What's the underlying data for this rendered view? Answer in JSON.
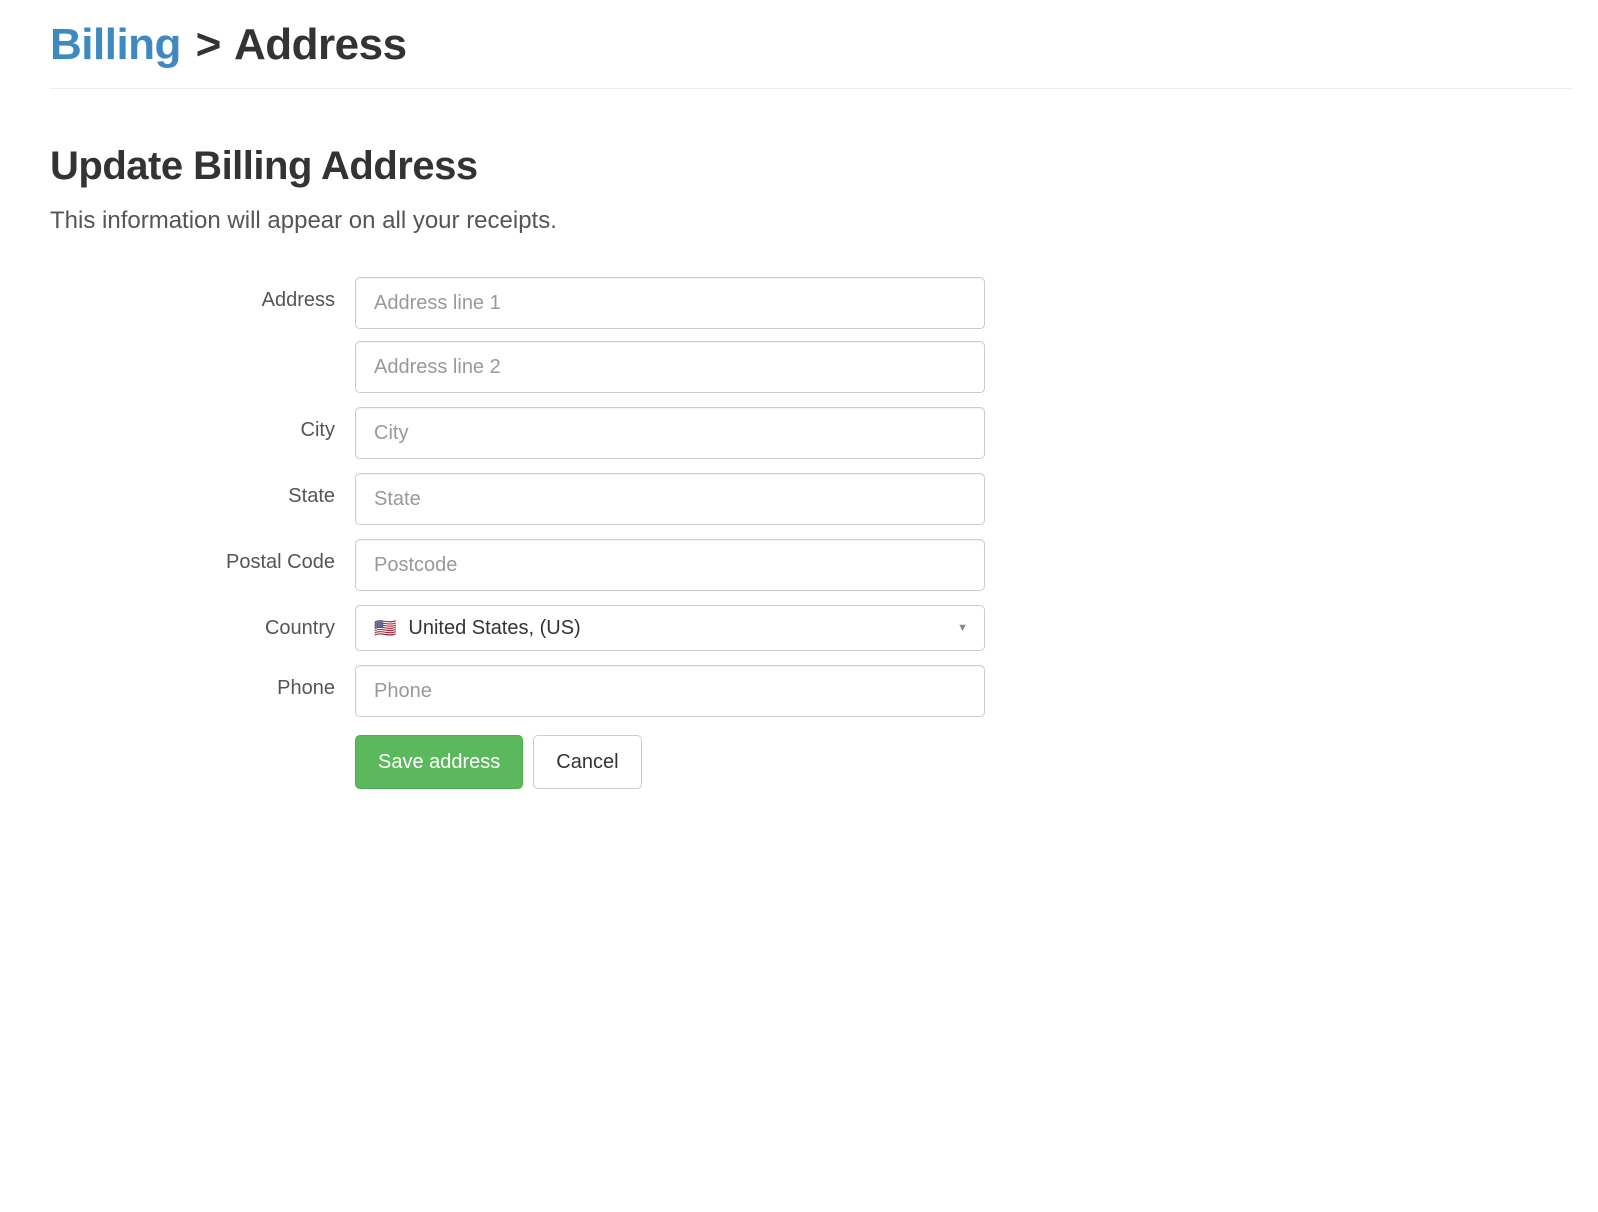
{
  "breadcrumb": {
    "parent": "Billing",
    "separator": ">",
    "current": "Address"
  },
  "header": {
    "title": "Update Billing Address",
    "subtitle": "This information will appear on all your receipts."
  },
  "form": {
    "address": {
      "label": "Address",
      "line1_placeholder": "Address line 1",
      "line1_value": "",
      "line2_placeholder": "Address line 2",
      "line2_value": ""
    },
    "city": {
      "label": "City",
      "placeholder": "City",
      "value": ""
    },
    "state": {
      "label": "State",
      "placeholder": "State",
      "value": ""
    },
    "postal": {
      "label": "Postal Code",
      "placeholder": "Postcode",
      "value": ""
    },
    "country": {
      "label": "Country",
      "flag": "🇺🇸",
      "selected": "United States, (US)"
    },
    "phone": {
      "label": "Phone",
      "placeholder": "Phone",
      "value": ""
    }
  },
  "buttons": {
    "save": "Save address",
    "cancel": "Cancel"
  }
}
